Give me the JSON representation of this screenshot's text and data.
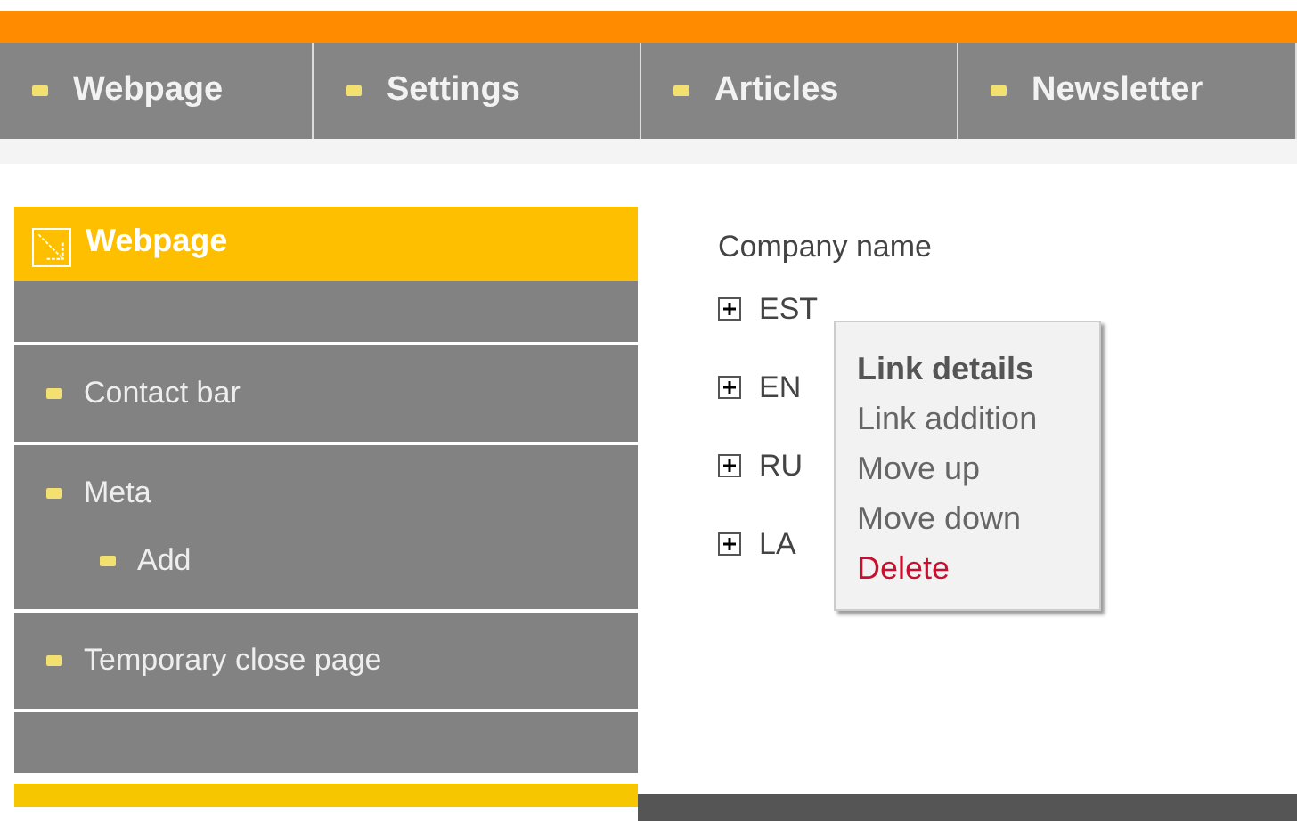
{
  "nav": [
    {
      "label": "Webpage"
    },
    {
      "label": "Settings"
    },
    {
      "label": "Articles"
    },
    {
      "label": "Newsletter"
    }
  ],
  "sidebar": {
    "title": "Webpage",
    "sections": [
      {
        "items": [
          {
            "label": "Contact bar"
          }
        ]
      },
      {
        "items": [
          {
            "label": "Meta",
            "children": [
              {
                "label": "Add"
              }
            ]
          }
        ]
      },
      {
        "items": [
          {
            "label": "Temporary close page"
          }
        ]
      }
    ]
  },
  "tree": {
    "root": "Company name",
    "nodes": [
      {
        "label": "EST"
      },
      {
        "label": "EN"
      },
      {
        "label": "RU"
      },
      {
        "label": "LA"
      }
    ]
  },
  "context_menu": [
    {
      "label": "Link details",
      "kind": "heading"
    },
    {
      "label": "Link addition",
      "kind": "normal"
    },
    {
      "label": "Move up",
      "kind": "normal"
    },
    {
      "label": "Move down",
      "kind": "normal"
    },
    {
      "label": "Delete",
      "kind": "danger"
    }
  ]
}
